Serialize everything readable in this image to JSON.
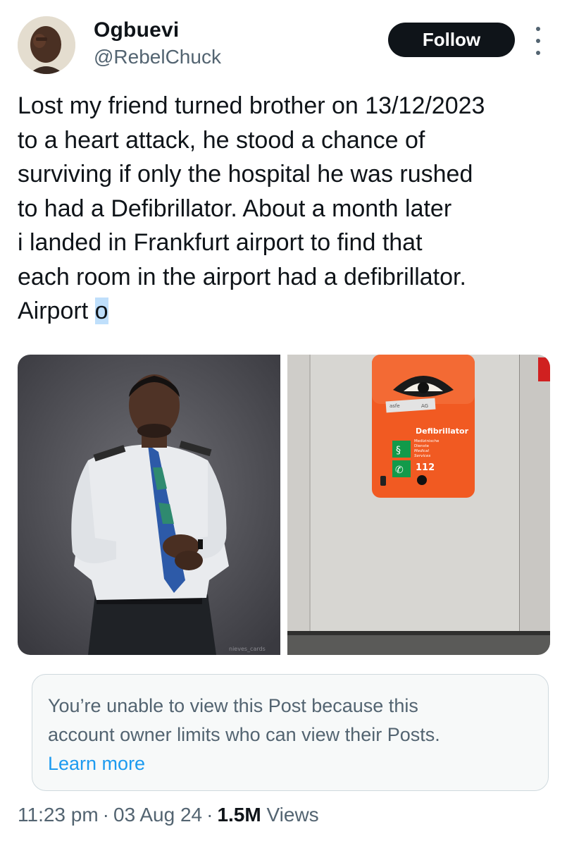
{
  "author": {
    "display_name": "Ogbuevi",
    "handle": "@RebelChuck"
  },
  "actions": {
    "follow_label": "Follow"
  },
  "tweet": {
    "lines": [
      "Lost my friend turned brother on 13/12/2023",
      "to a heart attack, he stood a chance of",
      "surviving if only the hospital he was rushed",
      "to had a Defibrillator. About a month later",
      "i landed in Frankfurt airport to find that",
      "each room in the airport had a defibrillator.",
      "Airport "
    ],
    "selected_char": "o"
  },
  "media": {
    "defib_labels": {
      "title": "Defibrillator",
      "sub1": "Medizinische",
      "sub2": "Dienste",
      "sub3": "Medical",
      "sub4": "Services",
      "phone": "112",
      "brand": "asfe",
      "brand2": "AG"
    },
    "watermark": "nieves_cards"
  },
  "quoted_notice": {
    "line1": "You’re unable to view this Post because this",
    "line2": "account owner limits who can view their Posts.",
    "link": "Learn more"
  },
  "meta": {
    "time": "11:23 pm",
    "separator": "·",
    "date": "03 Aug 24",
    "views_count": "1.5M",
    "views_label": "Views"
  },
  "colors": {
    "text_primary": "#0f1419",
    "text_secondary": "#536471",
    "link": "#1d9bf0",
    "defib_orange": "#f15a22",
    "aed_green": "#129a4a"
  }
}
